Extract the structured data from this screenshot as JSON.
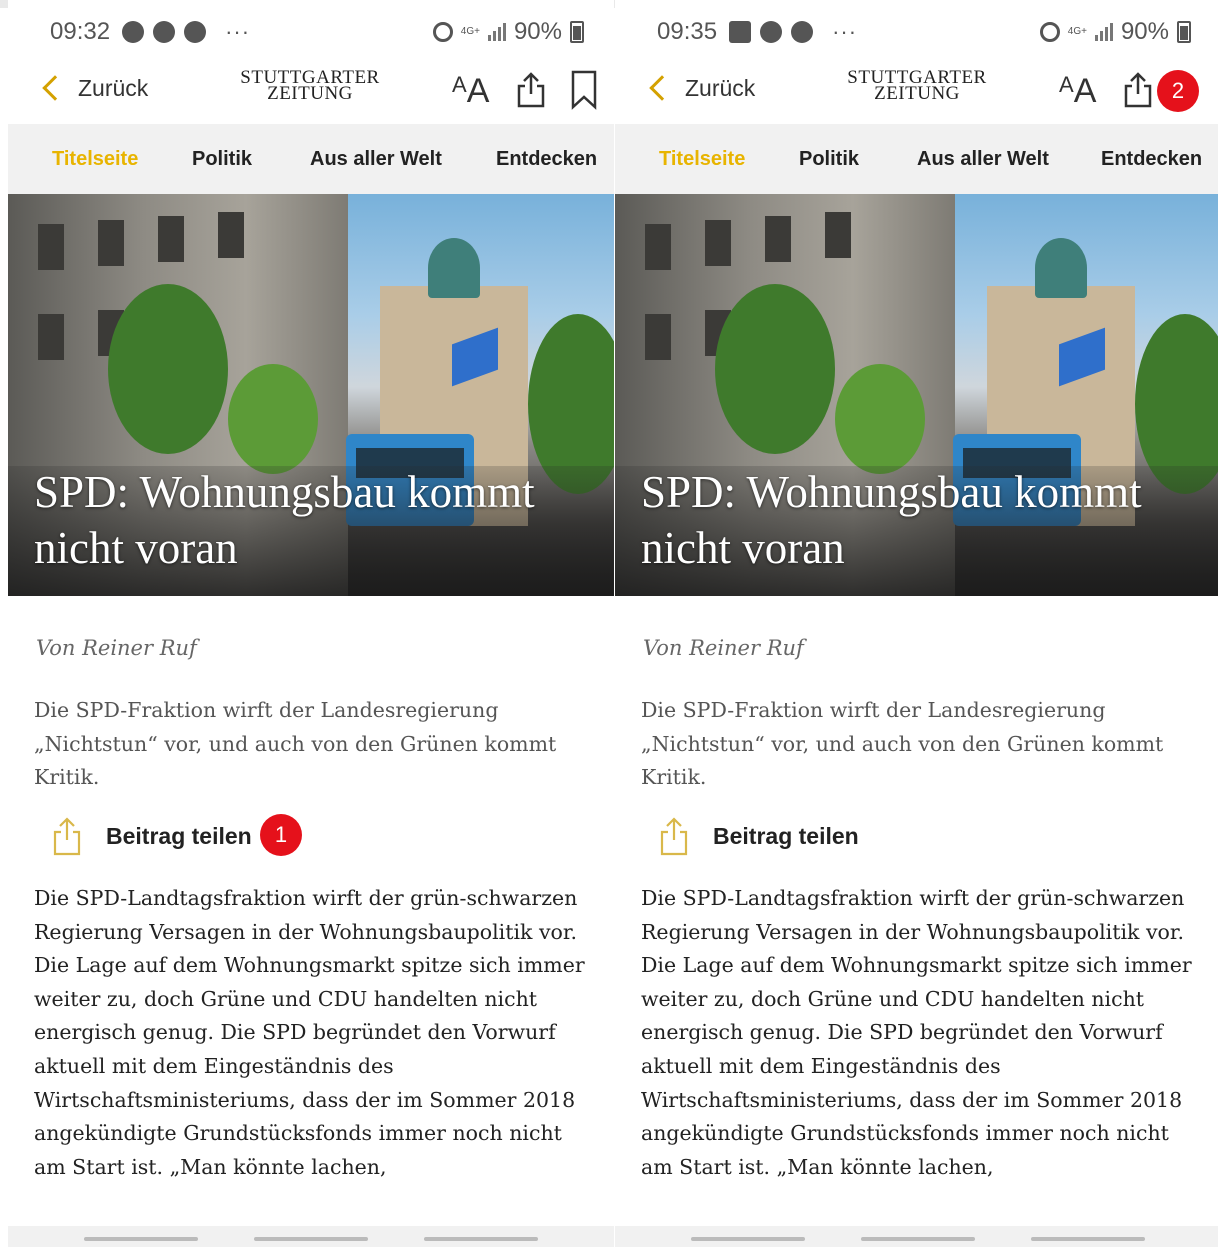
{
  "screens": [
    {
      "status": {
        "time": "09:32",
        "dots": "···",
        "lte": "4G+",
        "battery": "90%"
      },
      "app": {
        "back_label": "Zurück",
        "logo_line1": "STUTTGARTER",
        "logo_line2": "ZEITUNG",
        "text_size_label": "AA",
        "badge": ""
      },
      "tabs": [
        "Titelseite",
        "Politik",
        "Aus aller Welt",
        "Entdecken"
      ],
      "article": {
        "headline": "SPD: Wohnungsbau kommt nicht voran",
        "author": "Von Reiner Ruf",
        "teaser": "Die SPD-Fraktion wirft der Landesregierung „Nichtstun“ vor, und auch von den Grünen kommt Kritik.",
        "share_label": "Beitrag teilen",
        "share_badge": "1",
        "body": "Die SPD-Landtagsfraktion wirft der grün-schwarzen Regierung Versagen in der Wohnungsbaupolitik vor. Die Lage auf dem Wohnungsmarkt spitze sich immer weiter zu, doch Grüne und CDU handelten nicht energisch genug. Die SPD begründet den Vorwurf aktuell mit dem Eingeständnis des Wirtschaftsministeriums, dass der im Sommer 2018 angekündigte Grundstücksfonds immer noch nicht am Start ist. „Man könnte lachen,"
      }
    },
    {
      "status": {
        "time": "09:35",
        "dots": "···",
        "lte": "4G+",
        "battery": "90%"
      },
      "app": {
        "back_label": "Zurück",
        "logo_line1": "STUTTGARTER",
        "logo_line2": "ZEITUNG",
        "text_size_label": "AA",
        "badge": "2"
      },
      "tabs": [
        "Titelseite",
        "Politik",
        "Aus aller Welt",
        "Entdecken"
      ],
      "article": {
        "headline": "SPD: Wohnungsbau kommt nicht voran",
        "author": "Von Reiner Ruf",
        "teaser": "Die SPD-Fraktion wirft der Landesregierung „Nichtstun“ vor, und auch von den Grünen kommt Kritik.",
        "share_label": "Beitrag teilen",
        "share_badge": "",
        "body": "Die SPD-Landtagsfraktion wirft der grün-schwarzen Regierung Versagen in der Wohnungsbaupolitik vor. Die Lage auf dem Wohnungsmarkt spitze sich immer weiter zu, doch Grüne und CDU handelten nicht energisch genug. Die SPD begründet den Vorwurf aktuell mit dem Eingeständnis des Wirtschaftsministeriums, dass der im Sommer 2018 angekündigte Grundstücksfonds immer noch nicht am Start ist. „Man könnte lachen,"
      }
    }
  ],
  "colors": {
    "accent": "#e8b400",
    "badge": "#e5111b",
    "tabbar": "#f1f1f1"
  },
  "icons": [
    "back-chevron-icon",
    "text-size-icon",
    "share-icon",
    "bookmark-icon",
    "alarm-icon",
    "signal-icon",
    "battery-icon"
  ]
}
